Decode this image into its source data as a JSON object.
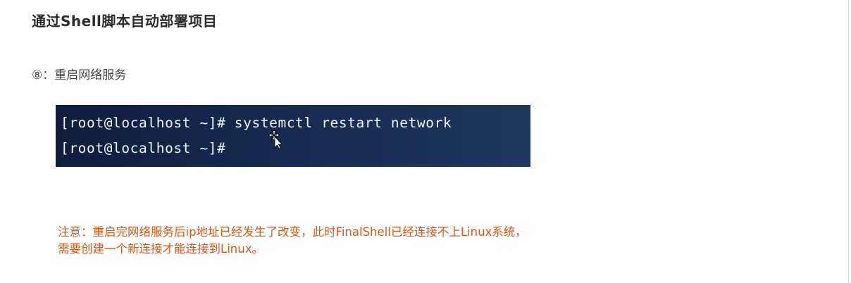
{
  "page": {
    "title": "通过Shell脚本自动部署项目"
  },
  "step": {
    "heading": "⑧：重启网络服务"
  },
  "terminal": {
    "lines": [
      "[root@localhost ~]# systemctl restart network",
      "[root@localhost ~]#"
    ]
  },
  "note": {
    "line1": "注意：重启完网络服务后ip地址已经发生了改变，此时FinalShell已经连接不上Linux系统，",
    "line2": "需要创建一个新连接才能连接到Linux。"
  },
  "colors": {
    "note_text": "#e05414",
    "terminal_background": "#182b54",
    "terminal_text": "#f2f4f8"
  },
  "icons": {
    "cursor": "move-cursor-icon"
  }
}
